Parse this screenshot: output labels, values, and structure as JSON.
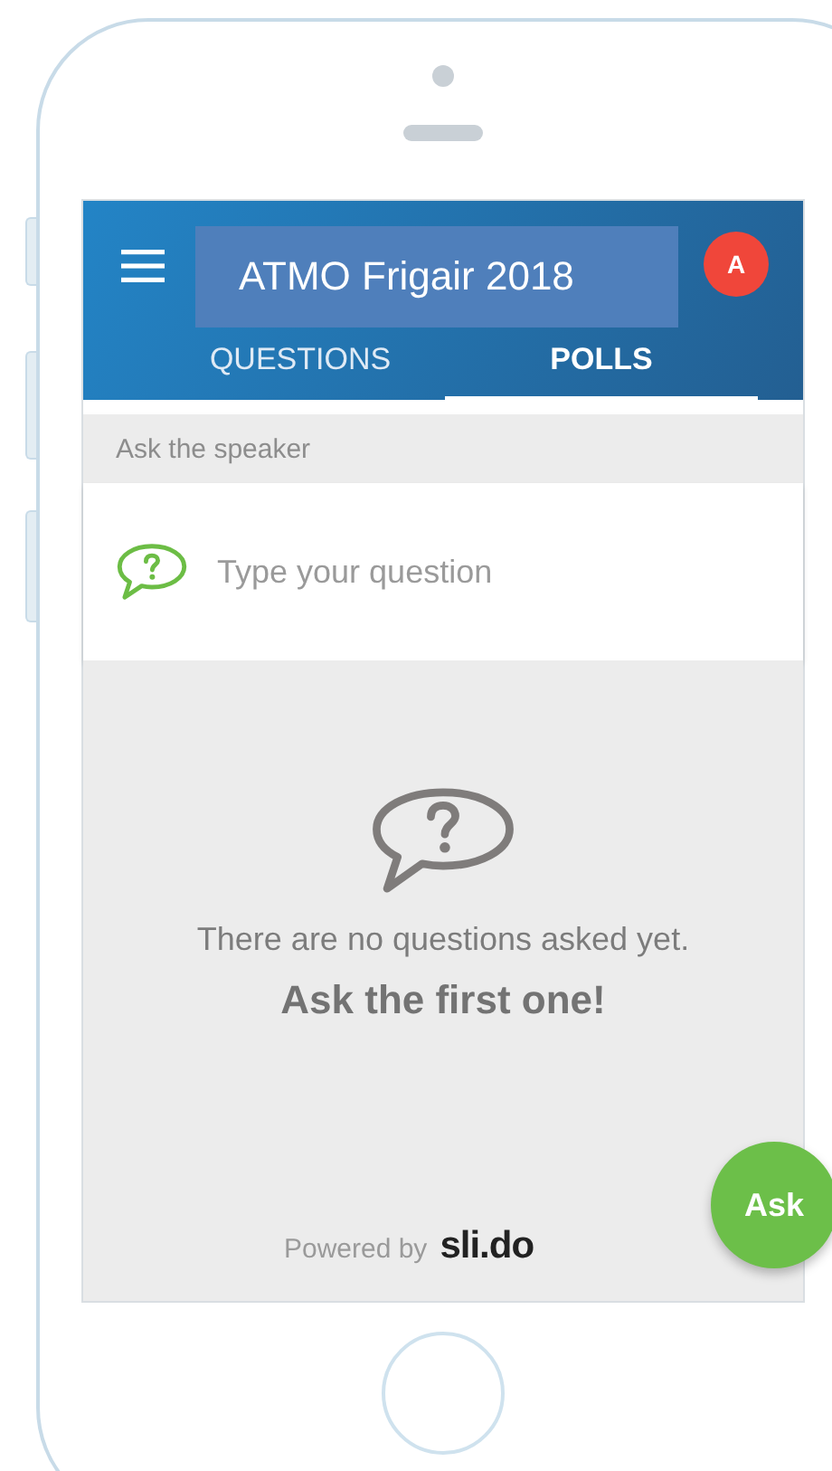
{
  "app_bar": {
    "title": "ATMO Frigair 2018",
    "avatar": "A"
  },
  "tabs": [
    {
      "label": "QUESTIONS",
      "selected": false
    },
    {
      "label": "POLLS",
      "selected": true
    }
  ],
  "section_label": "Ask the speaker",
  "question_field": {
    "placeholder": "Type your question"
  },
  "empty_state": {
    "message": "There are no questions asked yet.",
    "call_to_action": "Ask the first one!"
  },
  "ask_button": "Ask",
  "footer": {
    "powered_by": "Powered by",
    "logo": "sli.do"
  }
}
